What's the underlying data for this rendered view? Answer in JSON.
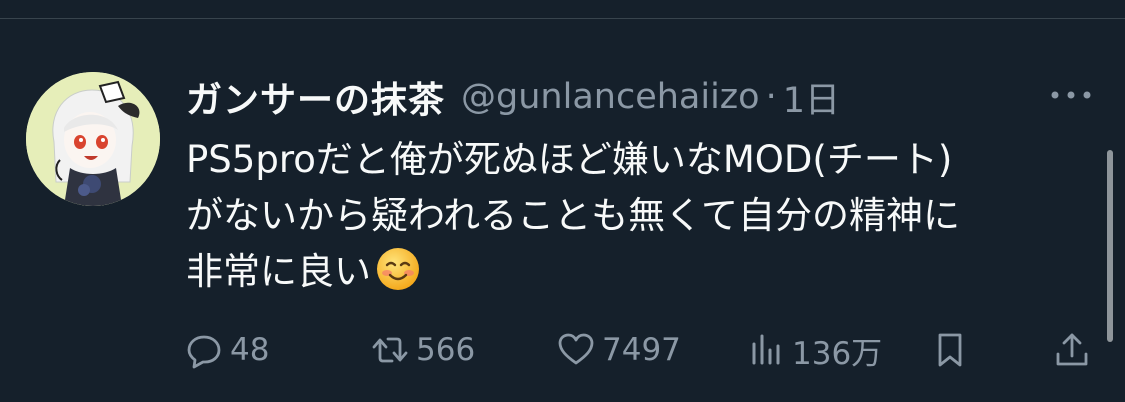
{
  "tweet": {
    "author_name": "ガンサーの抹茶",
    "handle": "@gunlancehaiizo",
    "separator": "·",
    "time": "1日",
    "text": "PS5proだと俺が死ぬほど嫌いなMOD(チート)\nがないから疑われることも無くて自分の精神に\n非常に良い",
    "emoji": "smiling-face-emoji"
  },
  "actions": {
    "replies": "48",
    "reposts": "566",
    "likes": "7497",
    "views": "136万"
  },
  "icons": {
    "reply": "reply-icon",
    "repost": "repost-icon",
    "like": "heart-icon",
    "views": "views-icon",
    "bookmark": "bookmark-icon",
    "share": "share-icon",
    "more": "more-icon"
  },
  "colors": {
    "background": "#15202b",
    "text": "#f7f9f9",
    "secondary": "#8b98a5",
    "divider": "#38444d",
    "avatar_bg": "#e6eeb9"
  }
}
